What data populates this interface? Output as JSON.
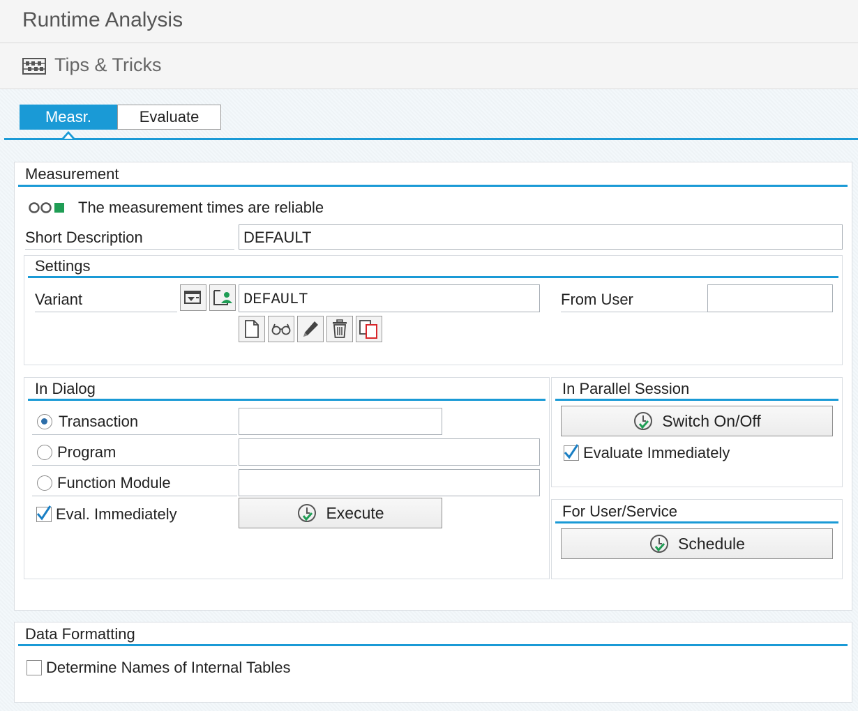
{
  "app": {
    "title": "Runtime Analysis"
  },
  "toolbar": {
    "tips_label": "Tips & Tricks"
  },
  "tabs": [
    {
      "label": "Measr.",
      "active": true
    },
    {
      "label": "Evaluate",
      "active": false
    }
  ],
  "measurement": {
    "title": "Measurement",
    "status_text": "The measurement times are reliable",
    "short_description_label": "Short Description",
    "short_description_value": "DEFAULT"
  },
  "settings": {
    "title": "Settings",
    "variant_label": "Variant",
    "variant_value": "DEFAULT",
    "from_user_label": "From User",
    "from_user_value": ""
  },
  "in_dialog": {
    "title": "In Dialog",
    "options": [
      {
        "label": "Transaction",
        "selected": true,
        "value": ""
      },
      {
        "label": "Program",
        "selected": false,
        "value": ""
      },
      {
        "label": "Function Module",
        "selected": false,
        "value": ""
      }
    ],
    "eval_label": "Eval. Immediately",
    "eval_checked": true,
    "execute_label": "Execute"
  },
  "parallel": {
    "title": "In Parallel Session",
    "switch_label": "Switch On/Off",
    "eval_label": "Evaluate Immediately",
    "eval_checked": true
  },
  "user_service": {
    "title": "For User/Service",
    "schedule_label": "Schedule"
  },
  "data_formatting": {
    "title": "Data Formatting",
    "determine_label": "Determine Names of Internal Tables",
    "determine_checked": false
  },
  "colors": {
    "accent": "#1a9ad6",
    "status_green": "#1f9d55"
  }
}
